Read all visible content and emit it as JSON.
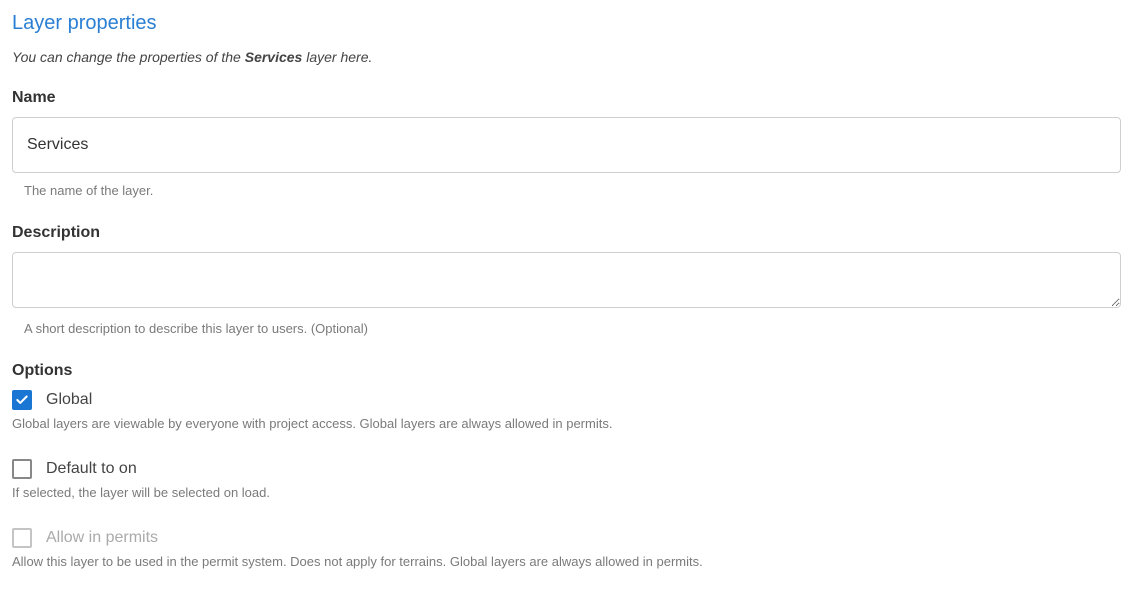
{
  "title": "Layer properties",
  "intro_prefix": "You can change the properties of the ",
  "intro_layer": "Services",
  "intro_suffix": " layer here.",
  "name": {
    "label": "Name",
    "value": "Services",
    "helper": "The name of the layer."
  },
  "description": {
    "label": "Description",
    "value": "",
    "helper": "A short description to describe this layer to users. (Optional)"
  },
  "options": {
    "label": "Options",
    "global": {
      "label": "Global",
      "checked": true,
      "disabled": false,
      "helper": "Global layers are viewable by everyone with project access. Global layers are always allowed in permits."
    },
    "default_on": {
      "label": "Default to on",
      "checked": false,
      "disabled": false,
      "helper": "If selected, the layer will be selected on load."
    },
    "allow_permits": {
      "label": "Allow in permits",
      "checked": false,
      "disabled": true,
      "helper": "Allow this layer to be used in the permit system. Does not apply for terrains. Global layers are always allowed in permits."
    }
  }
}
